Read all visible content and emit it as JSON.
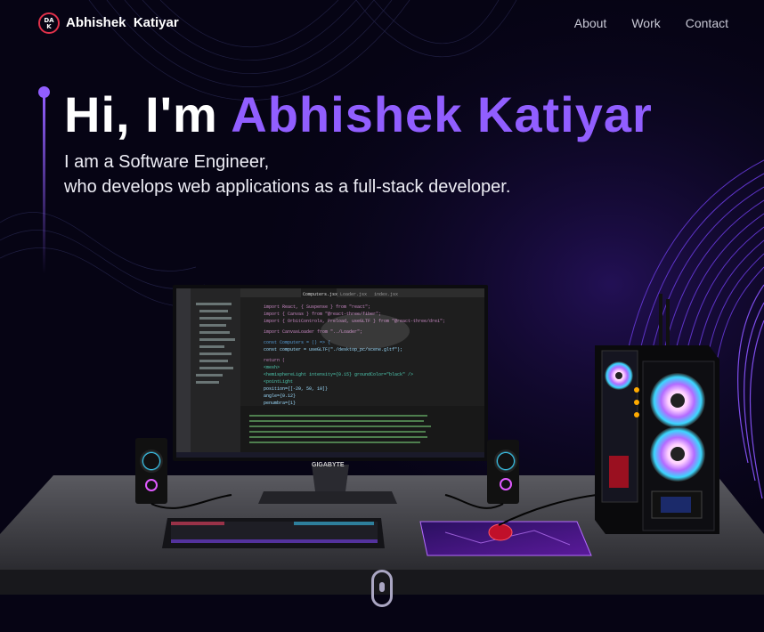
{
  "nav": {
    "logo_letters": "DAK",
    "brand": "Abhishek  Katiyar",
    "links": [
      "About",
      "Work",
      "Contact"
    ]
  },
  "hero": {
    "greeting": "Hi, I'm",
    "name": "Abhishek Katiyar",
    "line1": "I am a Software Engineer,",
    "line2": "who develops web applications as a full-stack developer."
  },
  "scene": {
    "monitor_brand": "GIGABYTE",
    "editor_tabs": [
      "Computers.jsx",
      "Loader.jsx",
      "index.jsx"
    ],
    "code_lines": [
      "import React, { Suspense } from \"react\";",
      "import { Canvas } from \"@react-three/fiber\";",
      "import { OrbitControls, Preload, useGLTF } from \"@react-three/drei\";",
      "import CanvasLoader from \"../Loader\";",
      "const Computers = () => {",
      "  const computer = useGLTF(\"./desktop_pc/scene.gltf\");",
      "  return (",
      "    <mesh>",
      "      <hemisphereLight intensity={0.15} groundColor=\"black\" />",
      "      <pointLight",
      "        position={[-20, 50, 10]}",
      "        angle={0.12}",
      "        penumbra={1}"
    ]
  },
  "colors": {
    "background": "#060414",
    "accent": "#915eff",
    "logo_ring": "#e0314a"
  },
  "icons": [
    "logo-badge",
    "mouse-scroll-icon"
  ]
}
